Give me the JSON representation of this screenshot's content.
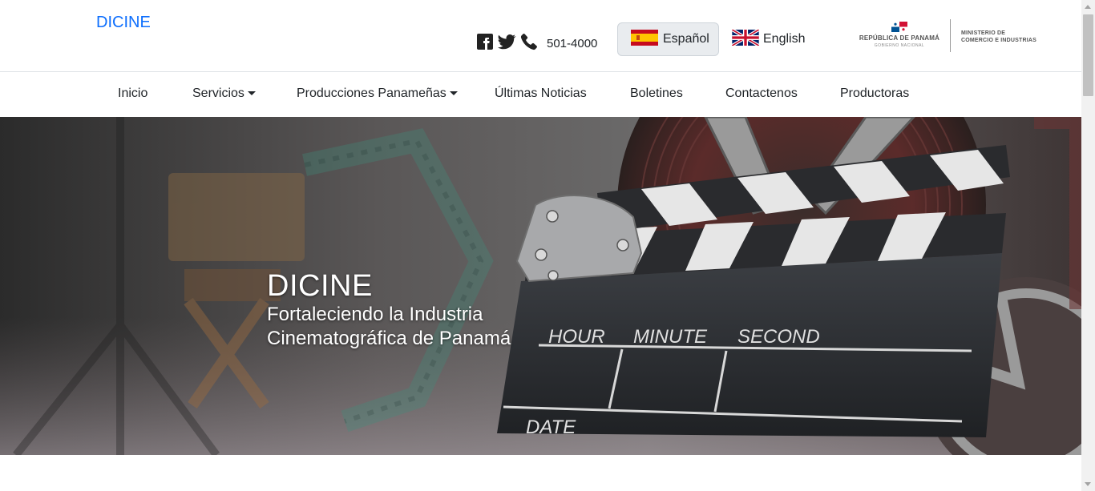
{
  "header": {
    "brand": "DICINE",
    "phone": "501-4000",
    "languages": {
      "spanish": "Español",
      "english": "English"
    },
    "government": {
      "republic": "REPÚBLICA DE PANAMÁ",
      "subtitle": "GOBIERNO NACIONAL",
      "ministry_line1": "MINISTERIO DE",
      "ministry_line2": "COMERCIO E INDUSTRIAS"
    },
    "icons": [
      "facebook-icon",
      "twitter-icon",
      "phone-icon"
    ]
  },
  "nav": {
    "items": [
      {
        "label": "Inicio",
        "dropdown": false
      },
      {
        "label": "Servicios",
        "dropdown": true
      },
      {
        "label": "Producciones Panameñas",
        "dropdown": true
      },
      {
        "label": "Últimas Noticias",
        "dropdown": false
      },
      {
        "label": "Boletines",
        "dropdown": false
      },
      {
        "label": "Contactenos",
        "dropdown": false
      },
      {
        "label": "Productoras",
        "dropdown": false
      }
    ]
  },
  "hero": {
    "title": "DICINE",
    "subtitle_line1": "Fortaleciendo la Industria",
    "subtitle_line2": "Cinematográfica de Panamá",
    "clapper": {
      "hour": "HOUR",
      "minute": "MINUTE",
      "second": "SECOND",
      "date": "DATE"
    }
  },
  "colors": {
    "brand_link": "#0d6efd",
    "lang_active_bg": "#e9ecef"
  }
}
